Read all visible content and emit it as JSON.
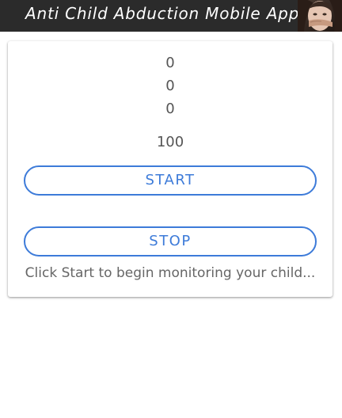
{
  "header": {
    "title": "Anti Child Abduction Mobile App",
    "background_color": "#2b2b2b",
    "photo_icon": "child-photo-icon"
  },
  "readings": {
    "x": "0",
    "y": "0",
    "z": "0",
    "threshold": "100"
  },
  "controls": {
    "start_label": "START",
    "stop_label": "STOP",
    "accent_color": "#3d7bd9"
  },
  "status": {
    "message": "Click Start to begin monitoring your child..."
  }
}
